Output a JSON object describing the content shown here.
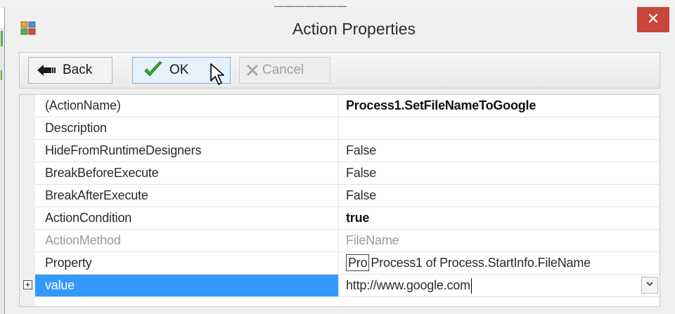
{
  "window": {
    "title": "Action Properties",
    "close_glyph": "✕"
  },
  "toolbar": {
    "back_label": "Back",
    "ok_label": "OK",
    "cancel_label": "Cancel"
  },
  "grid": {
    "rows": [
      {
        "name": "(ActionName)",
        "value": "Process1.SetFileNameToGoogle",
        "value_style": "bold"
      },
      {
        "name": "Description",
        "value": ""
      },
      {
        "name": "HideFromRuntimeDesigners",
        "value": "False"
      },
      {
        "name": "BreakBeforeExecute",
        "value": "False"
      },
      {
        "name": "BreakAfterExecute",
        "value": "False"
      },
      {
        "name": "ActionCondition",
        "value": "true",
        "value_style": "bold"
      },
      {
        "name": "ActionMethod",
        "value": "FileName",
        "name_style": "grey",
        "value_style": "grey"
      },
      {
        "name": "Property",
        "value_prefix": "Pro",
        "value": "Process1 of Process.StartInfo.FileName"
      },
      {
        "name": "value",
        "value": "http://www.google.com",
        "selected": true,
        "expander": "+"
      }
    ]
  },
  "icons": {
    "app": "app-icon",
    "back": "back-arrow-icon",
    "ok": "checkmark-icon",
    "cancel": "x-icon",
    "dropdown": "chevron-down-icon",
    "expander": "plus-box-icon"
  },
  "colors": {
    "selection": "#3399ff",
    "close": "#c9463d",
    "ok_check": "#3aa832"
  }
}
